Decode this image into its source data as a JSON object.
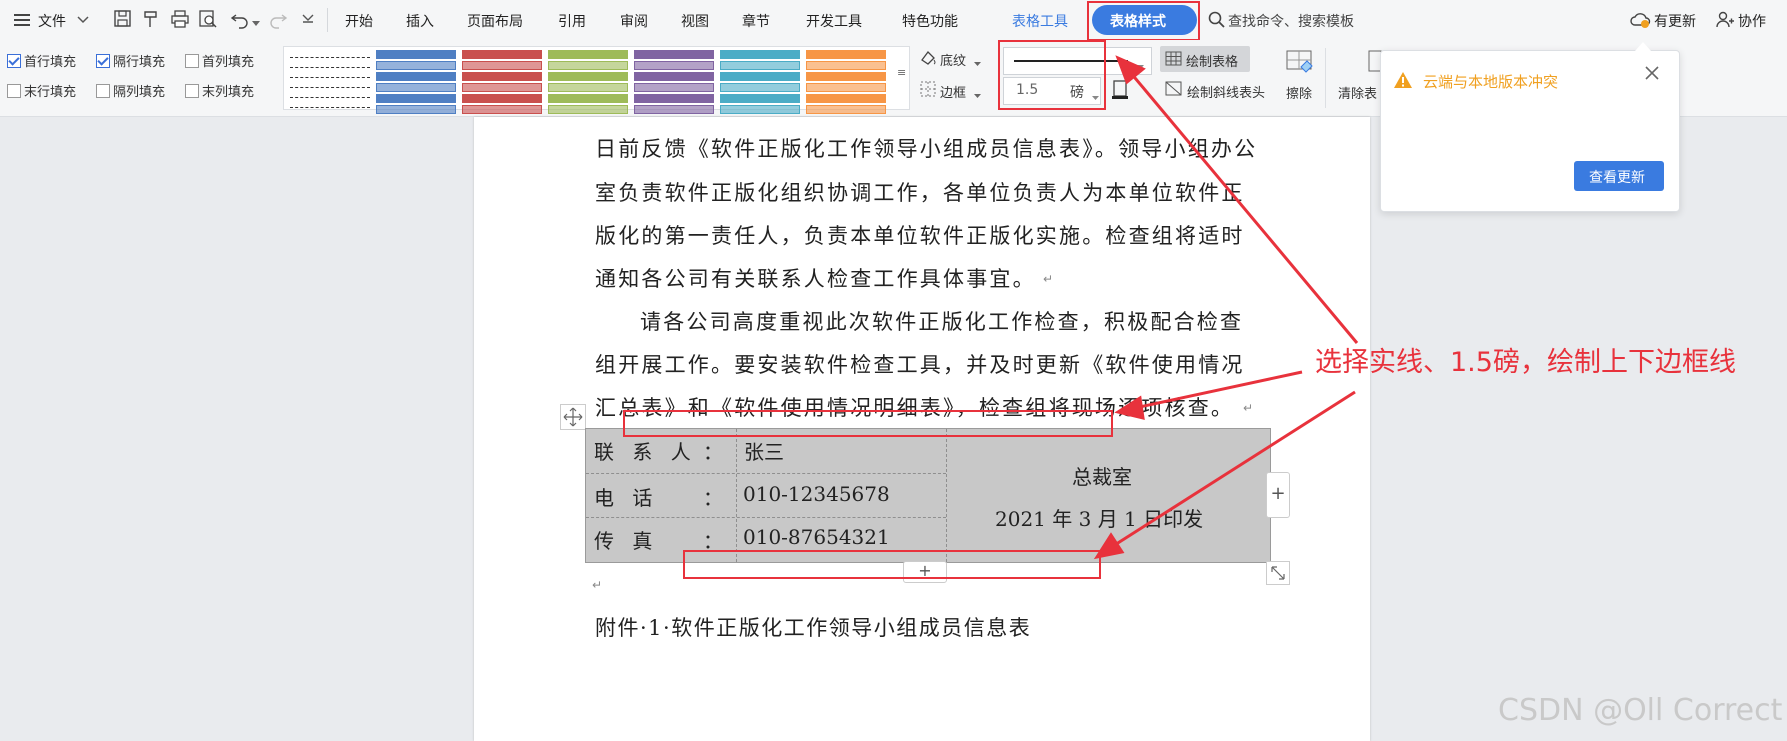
{
  "menubar": {
    "file": "文件",
    "tabs": [
      "开始",
      "插入",
      "页面布局",
      "引用",
      "审阅",
      "视图",
      "章节",
      "开发工具",
      "特色功能"
    ],
    "table_tools": "表格工具",
    "table_style": "表格样式",
    "search": "查找命令、搜索模板",
    "update": "有更新",
    "collab": "协作"
  },
  "ribbon": {
    "checkboxes": [
      {
        "label": "首行填充",
        "checked": true
      },
      {
        "label": "隔行填充",
        "checked": true
      },
      {
        "label": "首列填充",
        "checked": false
      },
      {
        "label": "末行填充",
        "checked": false
      },
      {
        "label": "隔列填充",
        "checked": false
      },
      {
        "label": "末列填充",
        "checked": false
      }
    ],
    "shading": "底纹",
    "border": "边框",
    "line_width": "1.5",
    "line_unit": "磅",
    "draw_table": "绘制表格",
    "draw_diagonal": "绘制斜线表头",
    "erase": "擦除",
    "clear": "清除表"
  },
  "swatch_colors": [
    "#ffffff",
    "#4f7fc3",
    "#c9504e",
    "#9ebb59",
    "#8064a2",
    "#4bacc6",
    "#f79646"
  ],
  "document": {
    "paragraphs": [
      "日前反馈《软件正版化工作领导小组成员信息表》。领导小组办公",
      "室负责软件正版化组织协调工作，各单位负责人为本单位软件正",
      "版化的第一责任人，负责本单位软件正版化实施。检查组将适时",
      "通知各公司有关联系人检查工作具体事宜。",
      "请各公司高度重视此次软件正版化工作检查，积极配合检查",
      "组开展工作。要安装软件检查工具，并及时更新《软件使用情况",
      "汇总表》和《软件使用情况明细表》，检查组将现场逐项核查。"
    ],
    "table": {
      "rows": [
        {
          "label": "联  系  人",
          "colon": "：",
          "value": "张三"
        },
        {
          "label": "电    话",
          "colon": "：",
          "value": "010-12345678"
        },
        {
          "label": "传    真",
          "colon": "：",
          "value": "010-87654321"
        }
      ],
      "right_line1": "总裁室",
      "right_line2": "2021 年 3 月 1 日印发"
    },
    "attachment": "附件·1·软件正版化工作领导小组成员信息表"
  },
  "annotation": "选择实线、1.5磅，绘制上下边框线",
  "popup": {
    "title": "云端与本地版本冲突",
    "button": "查看更新"
  },
  "watermark": "CSDN @Oll Correct",
  "colors": {
    "accent": "#3a7be0",
    "annotation": "#e8323c",
    "warning": "#f0a020"
  }
}
